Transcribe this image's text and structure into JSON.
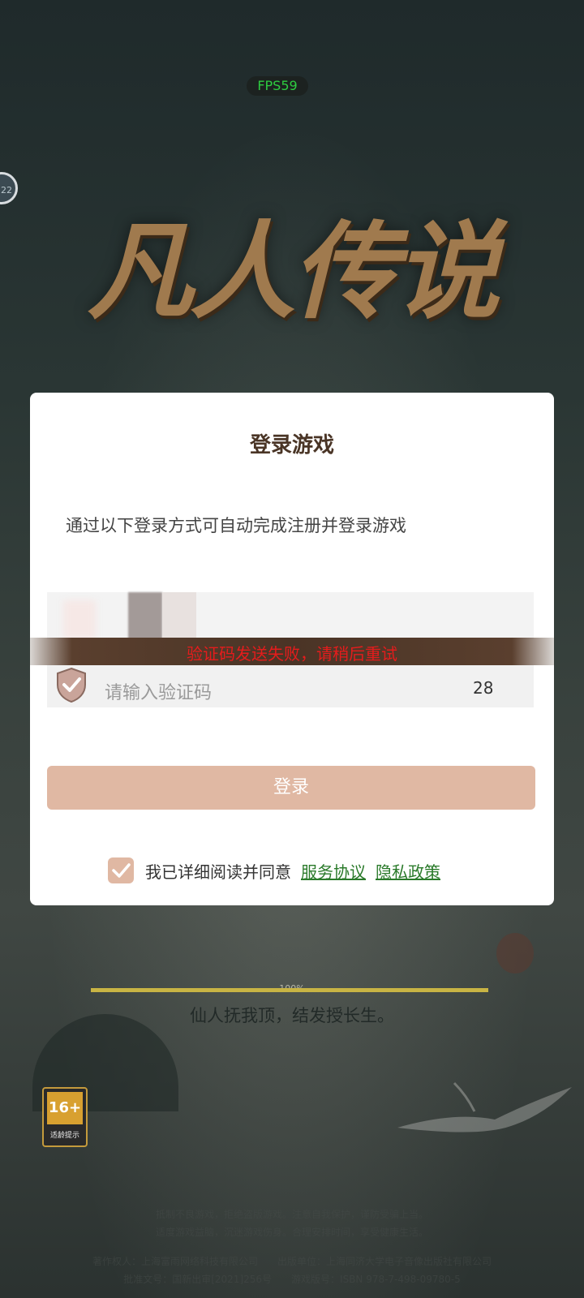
{
  "status": {
    "fps": "FPS59",
    "side_badge": "22"
  },
  "logo": {
    "text": "凡人传说"
  },
  "dialog": {
    "title": "登录游戏",
    "subtitle": "通过以下登录方式可自动完成注册并登录游戏",
    "error_message": "验证码发送失败，请稍后重试",
    "code_placeholder": "请输入验证码",
    "countdown": "28",
    "login_button": "登录",
    "agree_text": "我已详细阅读并同意",
    "service_link": "服务协议",
    "privacy_link": "隐私政策",
    "agree_checked": true
  },
  "loading": {
    "percent_label": "100%",
    "progress": 1.0,
    "tagline": "仙人抚我顶，结发授长生。"
  },
  "age_rating": {
    "badge": "16+",
    "label": "适龄提示"
  },
  "footer": {
    "line1": "抵制不良游戏，拒绝盗版游戏。注意自我保护，谨防受骗上当。",
    "line2": "适度游戏益脑，沉迷游戏伤身。合理安排时间，享受健康生活。",
    "line3": "著作权人：上海富雨网络科技有限公司　　出版单位：上海同济大学电子音像出版社有限公司",
    "line4": "批准文号：国新出审[2021]256号　　游戏版号：ISBN 978-7-498-09780-5"
  },
  "colors": {
    "accent": "#e0b8a3",
    "error": "#e51c1c",
    "link": "#2a7a2a",
    "title": "#4a3526"
  }
}
